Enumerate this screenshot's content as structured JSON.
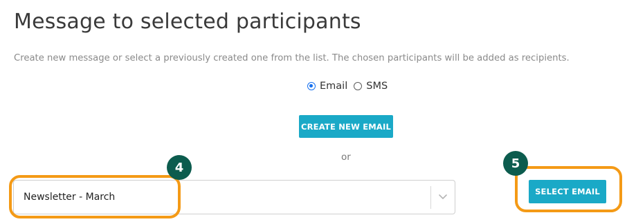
{
  "page": {
    "title": "Message to selected participants",
    "description": "Create new message or select a previously created one from the list. The chosen participants will be added as recipients."
  },
  "message_type": {
    "options": [
      {
        "label": "Email",
        "checked": true
      },
      {
        "label": "SMS",
        "checked": false
      }
    ]
  },
  "actions": {
    "create_label": "CREATE NEW EMAIL",
    "or_label": "or",
    "select_label": "SELECT EMAIL"
  },
  "email_select": {
    "selected_value": "Newsletter - March"
  },
  "annotations": {
    "step_select": "4",
    "step_button": "5"
  },
  "colors": {
    "accent_button": "#1aa9c7",
    "highlight_ring": "#f49a16",
    "badge_bg": "#0c5c4e",
    "radio_checked": "#1570ef"
  },
  "icons": {
    "select_arrow": "chevron-down-icon"
  }
}
